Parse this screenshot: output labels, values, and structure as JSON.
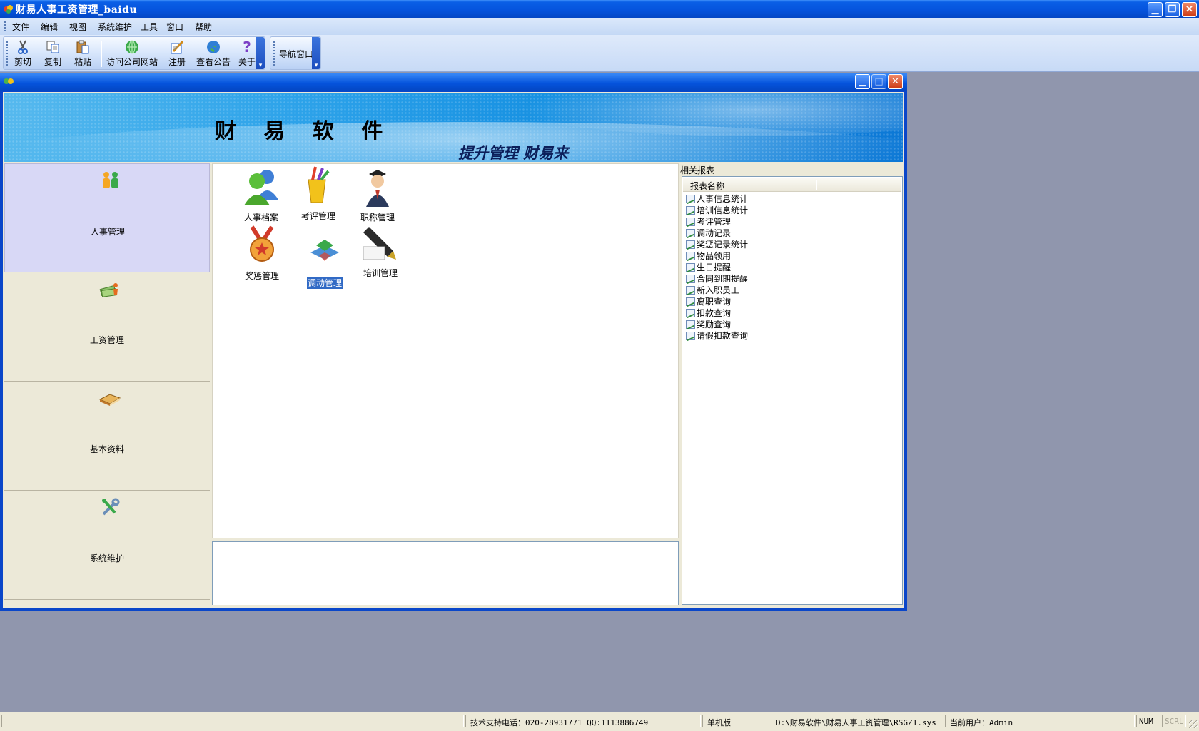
{
  "app": {
    "title": "财易人事工资管理_baidu"
  },
  "menu": [
    "文件",
    "编辑",
    "视图",
    "系统维护",
    "工具",
    "窗口",
    "帮助"
  ],
  "toolbar": {
    "buttons": [
      {
        "label": "剪切",
        "icon": "scissors-icon"
      },
      {
        "label": "复制",
        "icon": "copy-icon"
      },
      {
        "label": "粘贴",
        "icon": "paste-icon"
      },
      {
        "label": "访问公司网站",
        "icon": "web-icon"
      },
      {
        "label": "注册",
        "icon": "register-icon"
      },
      {
        "label": "查看公告",
        "icon": "globe-icon"
      },
      {
        "label": "关于",
        "icon": "help-icon"
      }
    ],
    "nav_window": "导航窗口"
  },
  "banner": {
    "title": "财 易 软 件",
    "slogan": "提升管理 财易来"
  },
  "nav": [
    {
      "label": "人事管理",
      "icon": "people-icon",
      "active": true
    },
    {
      "label": "工资管理",
      "icon": "money-icon",
      "active": false
    },
    {
      "label": "基本资料",
      "icon": "book-icon",
      "active": false
    },
    {
      "label": "系统维护",
      "icon": "tools-icon",
      "active": false
    }
  ],
  "modules": [
    {
      "label": "人事档案",
      "icon": "users-icon"
    },
    {
      "label": "考评管理",
      "icon": "pencil-cup-icon"
    },
    {
      "label": "职称管理",
      "icon": "graduate-icon"
    },
    {
      "label": "奖惩管理",
      "icon": "medal-icon"
    },
    {
      "label": "调动管理",
      "icon": "transfer-icon",
      "selected": true
    },
    {
      "label": "培训管理",
      "icon": "pen-nib-icon"
    }
  ],
  "reports": {
    "section_label": "相关报表",
    "column": "报表名称",
    "items": [
      "人事信息统计",
      "培训信息统计",
      "考评管理",
      "调动记录",
      "奖惩记录统计",
      "物品领用",
      "生日提醒",
      "合同到期提醒",
      "新入职员工",
      "离职查询",
      "扣款查询",
      "奖励查询",
      "请假扣款查询"
    ]
  },
  "status": {
    "support": "技术支持电话：020-28931771 QQ:1113886749",
    "edition": "单机版",
    "path": "D:\\财易软件\\财易人事工资管理\\RSGZ1.sys",
    "user": "当前用户：Admin",
    "num": "NUM",
    "scrl": "SCRL"
  },
  "colors": {
    "title_blue": "#0553dc",
    "selection": "#316ac5",
    "workspace": "#9096ad"
  }
}
